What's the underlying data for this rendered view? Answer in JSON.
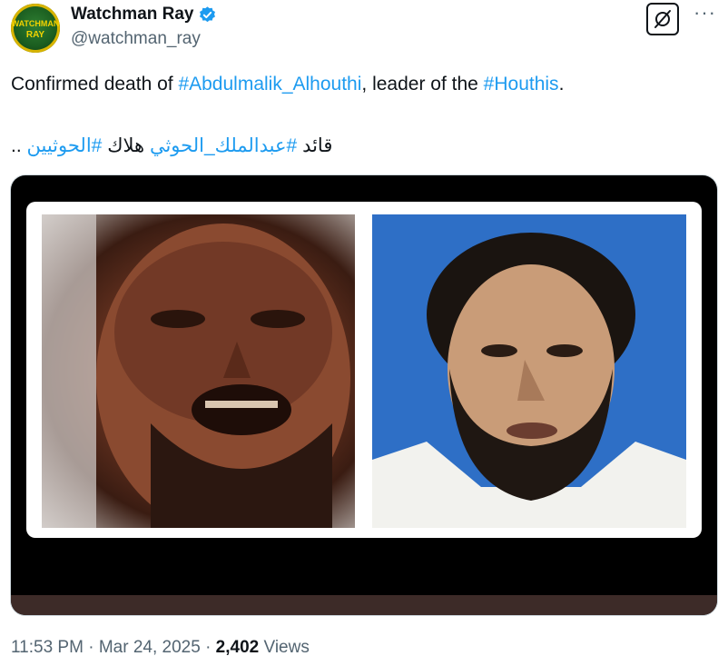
{
  "author": {
    "display_name": "Watchman Ray",
    "handle": "@watchman_ray",
    "avatar_text_line1": "WATCHMAN",
    "avatar_text_line2": "RAY"
  },
  "tweet": {
    "line1_prefix": "Confirmed death of ",
    "line1_hashtag1": "#Abdulmalik_Alhouthi",
    "line1_middle": ", leader of the ",
    "line1_hashtag2": "#Houthis",
    "line1_suffix": ".",
    "line2_word1": "قائد",
    "line2_hashtag1": "#عبدالملك_الحوثي",
    "line2_word2": "هلاك",
    "line2_hashtag2": "#الحوثيين",
    "line2_suffix": ".."
  },
  "meta": {
    "time": "11:53 PM",
    "separator": "·",
    "date": "Mar 24, 2025",
    "views_count": "2,402",
    "views_label": "Views"
  },
  "icons": {
    "verified": "verified-badge-icon",
    "grok": "grok-icon",
    "more": "more-options-icon"
  },
  "colors": {
    "accent": "#1d9bf0",
    "text": "#0f1419",
    "muted": "#536471"
  }
}
